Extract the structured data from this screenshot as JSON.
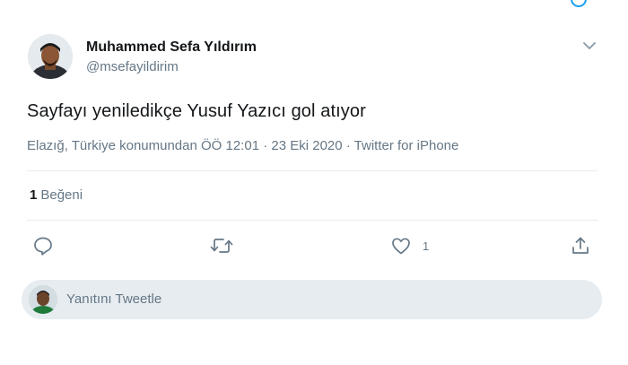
{
  "tweet": {
    "author_name": "Muhammed Sefa Yıldırım",
    "author_handle": "@msefayildirim",
    "text": "Sayfayı yeniledikçe Yusuf Yazıcı gol atıyor",
    "meta": "Elazığ, Türkiye konumundan ÖÖ 12:01 · 23 Eki 2020 · Twitter for iPhone",
    "likes_count": "1",
    "likes_label": "Beğeni"
  },
  "actions": {
    "reply_icon": "reply-icon",
    "retweet_icon": "retweet-icon",
    "like_icon": "heart-icon",
    "like_count": "1",
    "share_icon": "share-icon"
  },
  "reply": {
    "placeholder": "Yanıtını Tweetle"
  },
  "colors": {
    "accent": "#1da1f2",
    "secondary_text": "#657786",
    "reply_box_bg": "#e6ecf0",
    "icon": "#657786"
  }
}
